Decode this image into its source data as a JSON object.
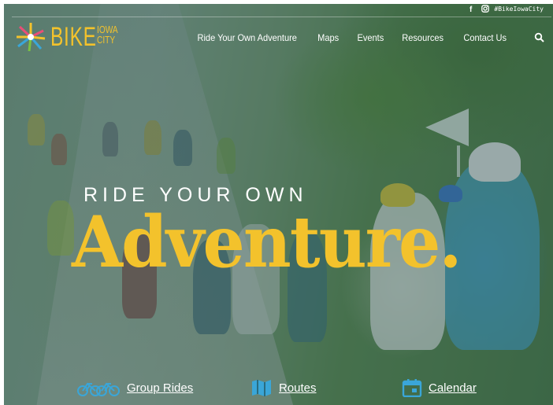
{
  "social": {
    "facebook_icon": "f",
    "instagram_icon": "instagram-icon",
    "hashtag": "#BikeIowaCity"
  },
  "logo": {
    "word": "BIKE",
    "line1": "IOWA",
    "line2": "CITY"
  },
  "nav": {
    "items": [
      "Ride Your Own Adventure",
      "Maps",
      "Events",
      "Resources",
      "Contact Us"
    ],
    "search_icon": "search-icon"
  },
  "hero": {
    "tagline": "RIDE YOUR OWN",
    "headline": "Adventure."
  },
  "quick_links": [
    {
      "label": "Group Rides",
      "icon": "bicycles-icon"
    },
    {
      "label": "Routes",
      "icon": "map-icon"
    },
    {
      "label": "Calendar",
      "icon": "calendar-icon"
    }
  ],
  "colors": {
    "brand_yellow": "#f3c22c",
    "accent_blue": "#3aa6d8",
    "overlay": "#1e4646"
  }
}
